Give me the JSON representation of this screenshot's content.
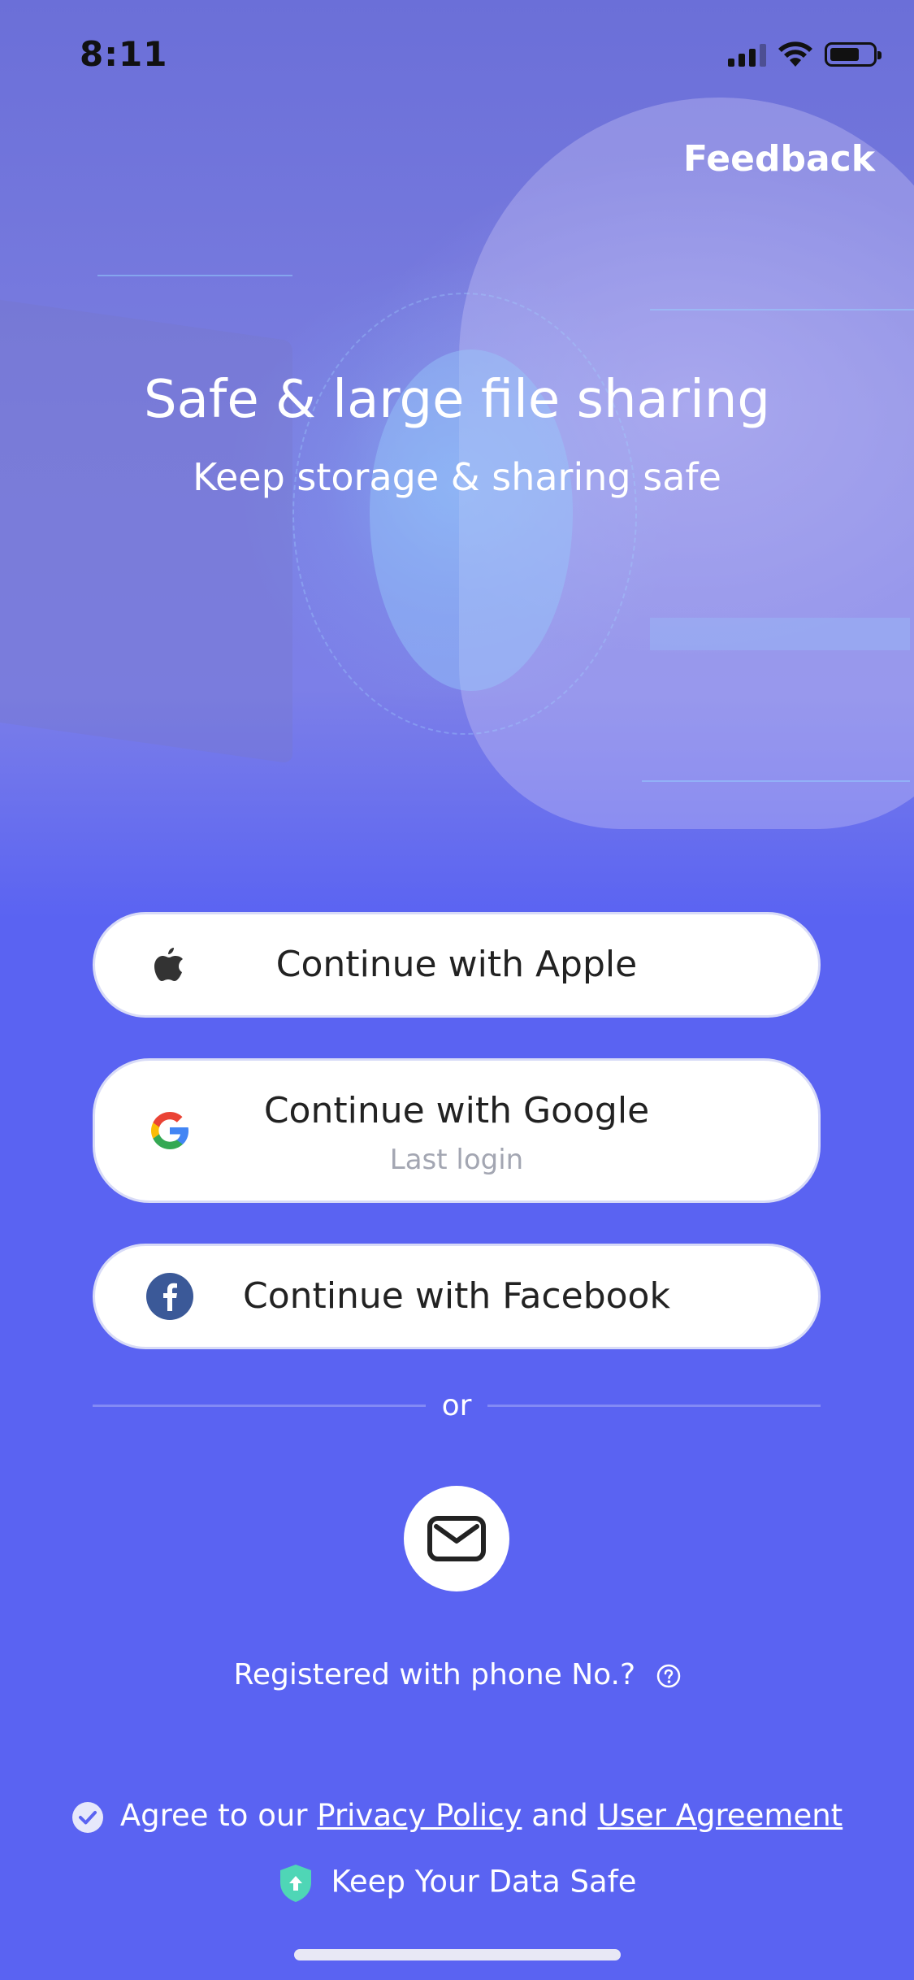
{
  "status_bar": {
    "time": "8:11"
  },
  "header": {
    "feedback_label": "Feedback"
  },
  "hero": {
    "title": "Safe & large file sharing",
    "subtitle": "Keep storage & sharing safe"
  },
  "login_buttons": {
    "apple": {
      "label": "Continue with Apple",
      "icon": "apple-icon"
    },
    "google": {
      "label": "Continue with Google",
      "sublabel": "Last login",
      "icon": "google-icon"
    },
    "facebook": {
      "label": "Continue with Facebook",
      "icon": "facebook-icon"
    }
  },
  "divider": {
    "or_label": "or"
  },
  "email_login": {
    "icon": "mail-icon"
  },
  "phone_prompt": {
    "label": "Registered with phone No.?"
  },
  "agreement": {
    "prefix": "Agree to our",
    "privacy_link": "Privacy Policy",
    "and": "and",
    "user_agreement_link": "User Agreement"
  },
  "safety": {
    "label": "Keep Your Data Safe"
  },
  "colors": {
    "background": "#5a63f2",
    "button_bg": "#ffffff",
    "facebook_blue": "#3b5998",
    "safe_green": "#4fd6b6"
  }
}
